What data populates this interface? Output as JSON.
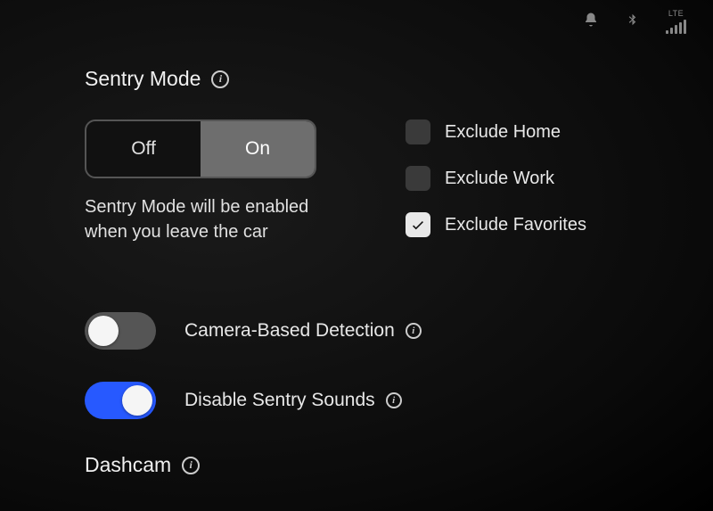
{
  "status": {
    "network_label": "LTE"
  },
  "sentry": {
    "title": "Sentry Mode",
    "toggle": {
      "off_label": "Off",
      "on_label": "On",
      "value": "on"
    },
    "description": "Sentry Mode will be enabled when you leave the car",
    "exclusions": {
      "home": {
        "label": "Exclude Home",
        "checked": false
      },
      "work": {
        "label": "Exclude Work",
        "checked": false
      },
      "favorites": {
        "label": "Exclude Favorites",
        "checked": true
      }
    },
    "options": {
      "camera_detection": {
        "label": "Camera-Based Detection",
        "enabled": false
      },
      "disable_sentry_sounds": {
        "label": "Disable Sentry Sounds",
        "enabled": true
      }
    }
  },
  "dashcam": {
    "title": "Dashcam"
  }
}
